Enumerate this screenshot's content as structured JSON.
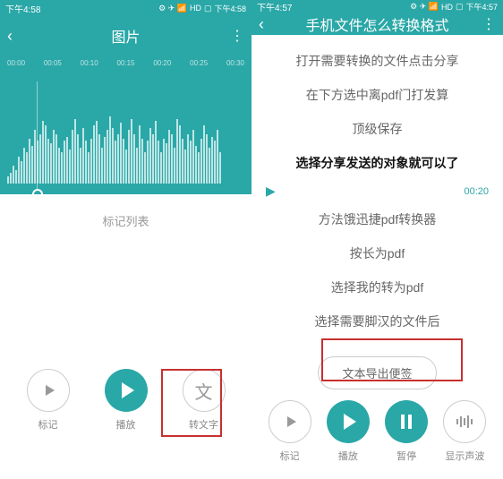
{
  "left": {
    "status": {
      "time": "下午4:58",
      "signal": "HD",
      "ind": "⏰ ✈ 📶"
    },
    "header": {
      "title": "图片"
    },
    "timemarks": [
      "00:00",
      "00:05",
      "00:10",
      "00:15",
      "00:20",
      "00:25",
      "00:30"
    ],
    "marker_list_label": "标记列表",
    "controls": {
      "mark": "标记",
      "play": "播放",
      "to_text": "转文字",
      "text_char": "文"
    }
  },
  "right": {
    "status": {
      "time": "下午4:57",
      "signal": "HD"
    },
    "header": {
      "title": "手机文件怎么转换格式"
    },
    "lines": [
      "打开需要转换的文件点击分享",
      "在下方选中离pdf门打发算",
      "顶级保存",
      "选择分享发送的对象就可以了",
      "方法饿迅捷pdf转换器",
      "按长为pdf",
      "选择我的转为pdf",
      "选择需要脚汉的文件后"
    ],
    "timestamp": "00:20",
    "export_label": "文本导出便签",
    "controls": {
      "mark": "标记",
      "play": "播放",
      "pause": "暂停",
      "show_wave": "显示声波"
    }
  }
}
